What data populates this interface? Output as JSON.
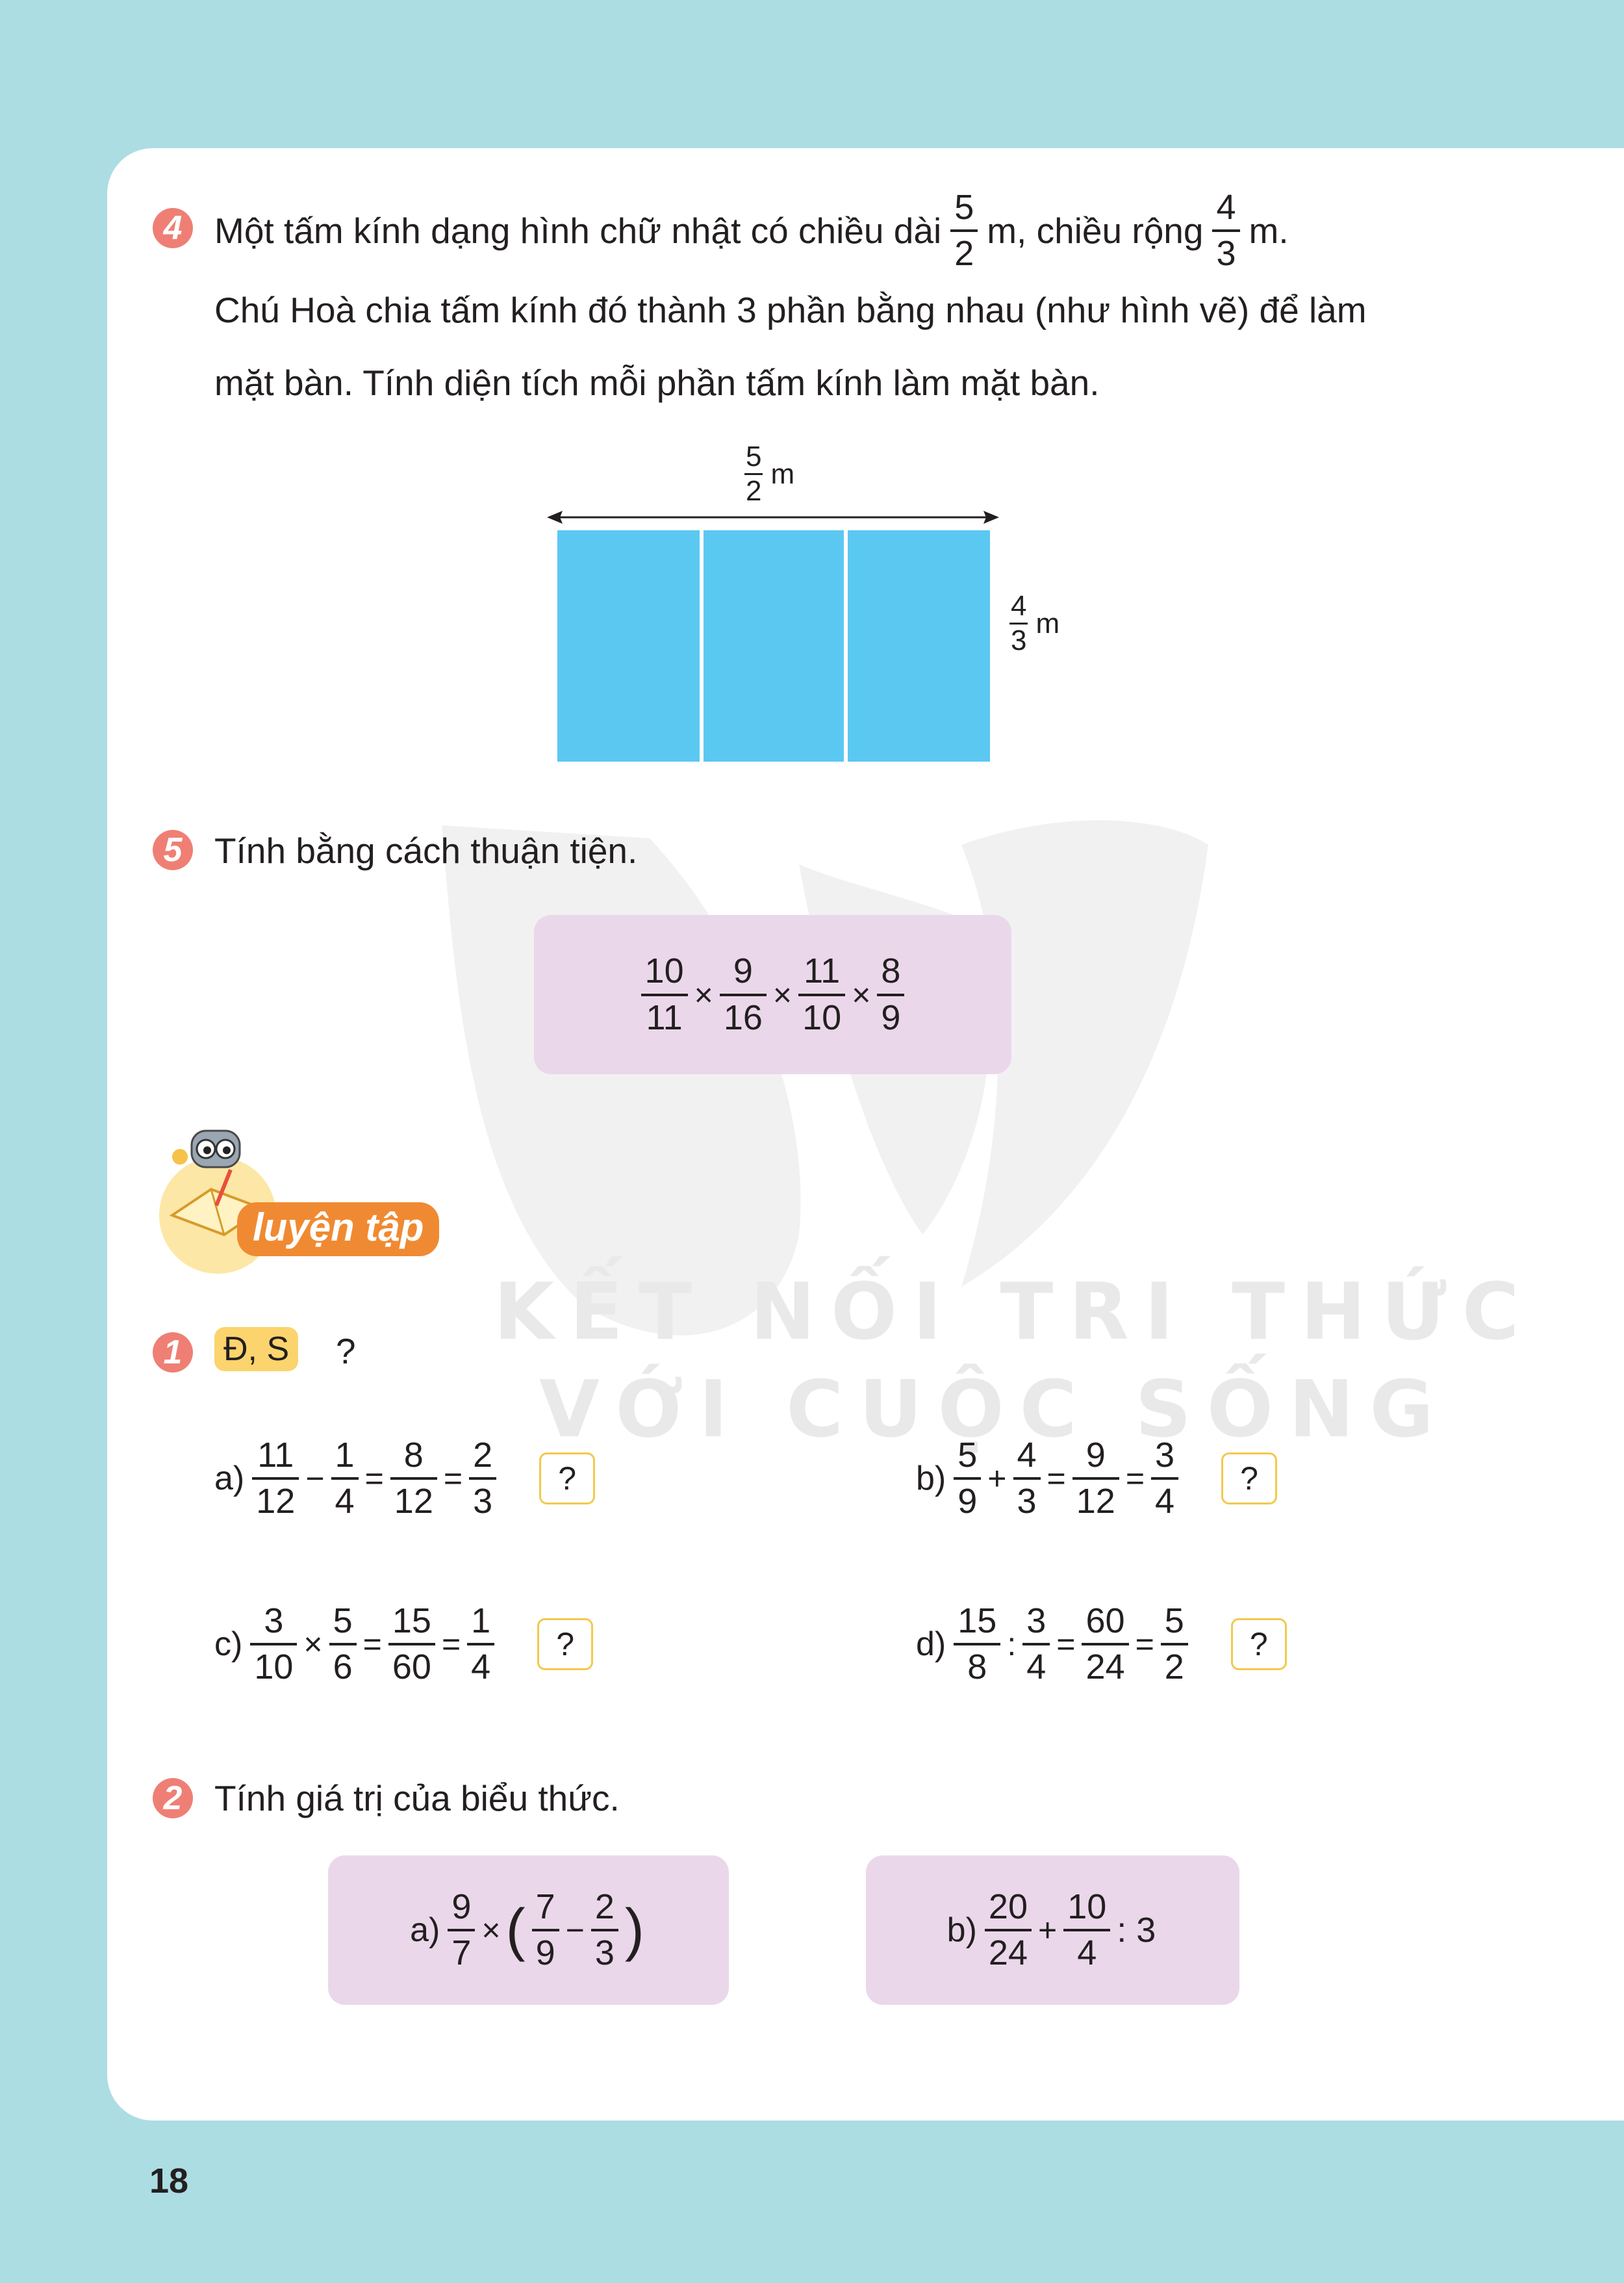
{
  "exercise4": {
    "number": "4",
    "line1_a": "Một tấm kính dạng hình chữ nhật có chiều dài",
    "length_num": "5",
    "length_den": "2",
    "line1_b": "m, chiều rộng",
    "width_num": "4",
    "width_den": "3",
    "line1_c": "m.",
    "line2": "Chú Hoà chia tấm kính đó thành 3 phần bằng nhau (như hình vẽ) để làm",
    "line3": "mặt bàn. Tính diện tích mỗi phần tấm kính làm mặt bàn.",
    "figure": {
      "top_label_num": "5",
      "top_label_den": "2",
      "top_label_unit": "m",
      "side_label_num": "4",
      "side_label_den": "3",
      "side_label_unit": "m",
      "parts": 3,
      "fill_color": "#5bc8f2"
    }
  },
  "exercise5": {
    "number": "5",
    "prompt": "Tính bằng cách thuận tiện.",
    "fractions": [
      {
        "n": "10",
        "d": "11"
      },
      {
        "n": "9",
        "d": "16"
      },
      {
        "n": "11",
        "d": "10"
      },
      {
        "n": "8",
        "d": "9"
      }
    ],
    "operator": "×"
  },
  "practice": {
    "title": "luyện tập",
    "ex1": {
      "number": "1",
      "tag": "Đ, S",
      "question_mark": "?",
      "items": [
        {
          "label": "a)",
          "box": "?"
        },
        {
          "label": "b)",
          "box": "?"
        },
        {
          "label": "c)",
          "box": "?"
        },
        {
          "label": "d)",
          "box": "?"
        }
      ]
    },
    "ex2": {
      "number": "2",
      "prompt": "Tính giá trị của biểu thức.",
      "a_label": "a)",
      "b_label": "b)",
      "b_tail": ": 3"
    }
  },
  "watermark": {
    "line1": "KẾT NỐI TRI THỨC",
    "line2": "VỚI CUỘC SỐNG"
  },
  "page_number": "18"
}
